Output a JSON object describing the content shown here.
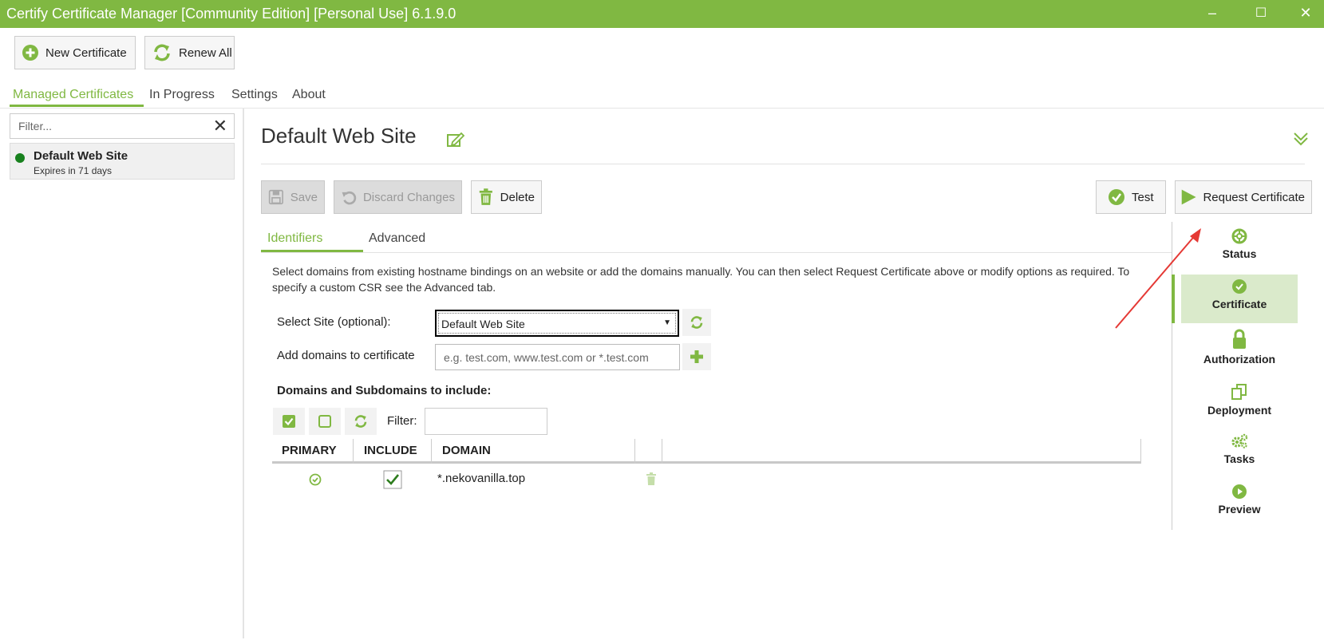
{
  "window": {
    "title": "Certify Certificate Manager [Community Edition] [Personal Use] 6.1.9.0",
    "minimize": "–",
    "maximize": "☐",
    "close": "✕"
  },
  "toolbar": {
    "new_certificate": "New Certificate",
    "renew_all": "Renew All"
  },
  "main_tabs": {
    "managed": "Managed Certificates",
    "in_progress": "In Progress",
    "settings": "Settings",
    "about": "About"
  },
  "sidebar": {
    "filter_placeholder": "Filter...",
    "clear": "✕",
    "items": [
      {
        "name": "Default Web Site",
        "expires": "Expires in 71 days",
        "status_color": "#18811e"
      }
    ]
  },
  "detail": {
    "title": "Default Web Site",
    "actions": {
      "save": "Save",
      "discard": "Discard Changes",
      "delete": "Delete",
      "test": "Test",
      "request": "Request Certificate"
    },
    "tabs": {
      "identifiers": "Identifiers",
      "advanced": "Advanced"
    },
    "description": "Select domains from existing hostname bindings on an website or add the domains manually. You can then select Request Certificate above or modify options as required. To specify a custom CSR see the Advanced tab.",
    "select_site_label": "Select Site (optional):",
    "select_site_value": "Default Web Site",
    "add_domains_label": "Add domains to certificate",
    "add_domains_placeholder": "e.g. test.com, www.test.com or *.test.com",
    "domains_heading": "Domains and Subdomains to include:",
    "filter_label": "Filter:",
    "table": {
      "headers": {
        "primary": "PRIMARY",
        "include": "INCLUDE",
        "domain": "DOMAIN"
      },
      "rows": [
        {
          "domain": "*.nekovanilla.top",
          "primary": true,
          "include": true
        }
      ]
    }
  },
  "nav": {
    "status": "Status",
    "certificate": "Certificate",
    "authorization": "Authorization",
    "deployment": "Deployment",
    "tasks": "Tasks",
    "preview": "Preview"
  },
  "colors": {
    "accent": "#80b842",
    "active_nav_bg": "#daeacb",
    "annotation_arrow": "#e53935"
  }
}
